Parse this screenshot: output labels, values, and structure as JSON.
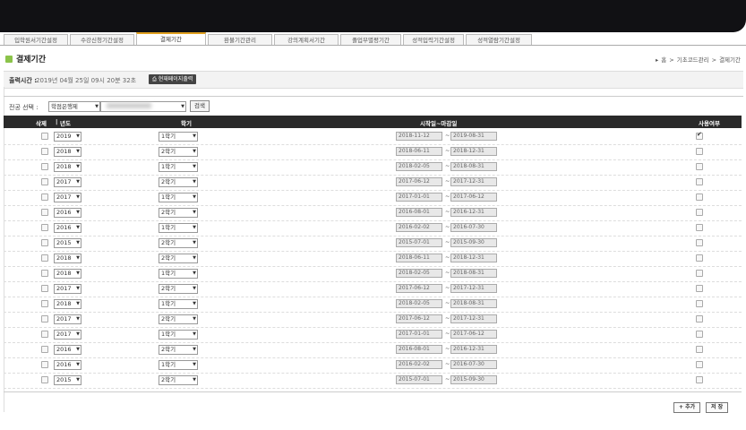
{
  "tabs": [
    {
      "label": "입학원서기간설정",
      "active": false
    },
    {
      "label": "수강신청기간설정",
      "active": false
    },
    {
      "label": "결제기간",
      "active": true
    },
    {
      "label": "환불기간관리",
      "active": false
    },
    {
      "label": "강의계획서기간",
      "active": false
    },
    {
      "label": "졸업부별평기간",
      "active": false
    },
    {
      "label": "성적입력기간설정",
      "active": false
    },
    {
      "label": "성적열람기간설정",
      "active": false
    }
  ],
  "page": {
    "title": "결제기간"
  },
  "breadcrumb": [
    "▸",
    "홈",
    ">",
    "기초코드관리",
    ">",
    "결제기간"
  ],
  "info": {
    "label": "출력시간 :",
    "value": "2019년 04월 25일 09시 20분 32초",
    "print_button": "현재페이지출력"
  },
  "filter": {
    "label": "전공 선택 :",
    "major": "학점은행제",
    "search_button": "검색"
  },
  "table": {
    "headers": {
      "delete": "삭제",
      "year": "년도",
      "semester": "학기",
      "period": "시작일~마감일",
      "use": "사용여부"
    },
    "rows": [
      {
        "year": "2019",
        "semester": "1학기",
        "start": "2018-11-12",
        "end": "2019-08-31",
        "use": true
      },
      {
        "year": "2018",
        "semester": "2학기",
        "start": "2018-06-11",
        "end": "2018-12-31",
        "use": false
      },
      {
        "year": "2018",
        "semester": "1학기",
        "start": "2018-02-05",
        "end": "2018-08-31",
        "use": false
      },
      {
        "year": "2017",
        "semester": "2학기",
        "start": "2017-06-12",
        "end": "2017-12-31",
        "use": false
      },
      {
        "year": "2017",
        "semester": "1학기",
        "start": "2017-01-01",
        "end": "2017-06-12",
        "use": false
      },
      {
        "year": "2016",
        "semester": "2학기",
        "start": "2016-08-01",
        "end": "2016-12-31",
        "use": false
      },
      {
        "year": "2016",
        "semester": "1학기",
        "start": "2016-02-02",
        "end": "2016-07-30",
        "use": false
      },
      {
        "year": "2015",
        "semester": "2학기",
        "start": "2015-07-01",
        "end": "2015-09-30",
        "use": false
      },
      {
        "year": "2018",
        "semester": "2학기",
        "start": "2018-06-11",
        "end": "2018-12-31",
        "use": false
      },
      {
        "year": "2018",
        "semester": "1학기",
        "start": "2018-02-05",
        "end": "2018-08-31",
        "use": false
      },
      {
        "year": "2017",
        "semester": "2학기",
        "start": "2017-06-12",
        "end": "2017-12-31",
        "use": false
      },
      {
        "year": "2018",
        "semester": "1학기",
        "start": "2018-02-05",
        "end": "2018-08-31",
        "use": false
      },
      {
        "year": "2017",
        "semester": "2학기",
        "start": "2017-06-12",
        "end": "2017-12-31",
        "use": false
      },
      {
        "year": "2017",
        "semester": "1학기",
        "start": "2017-01-01",
        "end": "2017-06-12",
        "use": false
      },
      {
        "year": "2016",
        "semester": "2학기",
        "start": "2016-08-01",
        "end": "2016-12-31",
        "use": false
      },
      {
        "year": "2016",
        "semester": "1학기",
        "start": "2016-02-02",
        "end": "2016-07-30",
        "use": false
      },
      {
        "year": "2015",
        "semester": "2학기",
        "start": "2015-07-01",
        "end": "2015-09-30",
        "use": false
      }
    ]
  },
  "actions": {
    "add": "+ 추가",
    "save": "저 장"
  }
}
